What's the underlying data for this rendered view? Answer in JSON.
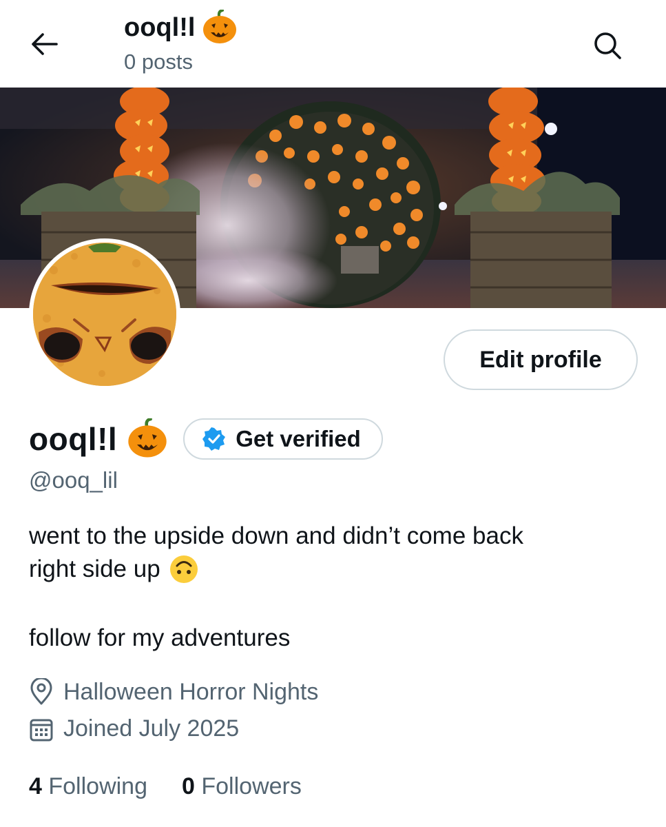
{
  "header": {
    "title": "ooql!l",
    "posts_count": "0 posts"
  },
  "profile": {
    "display_name": "ooql!l",
    "handle": "@ooq_lil",
    "bio_line1": "went to the upside down and didn’t come back",
    "bio_line2": "right side up",
    "bio_line3": "follow for my adventures",
    "location": "Halloween Horror Nights",
    "joined": "Joined July 2025"
  },
  "actions": {
    "edit_profile": "Edit profile",
    "get_verified": "Get verified"
  },
  "stats": {
    "following_count": "4",
    "following_label": "Following",
    "followers_count": "0",
    "followers_label": "Followers"
  },
  "icons": {
    "back": "arrow-left-icon",
    "search": "search-icon",
    "verified": "verified-badge-icon",
    "location": "location-pin-icon",
    "calendar": "calendar-icon",
    "emoji_title": "jack-o-lantern-emoji",
    "emoji_bio": "upside-down-face-emoji"
  },
  "colors": {
    "text_primary": "#0f1419",
    "text_secondary": "#536471",
    "border": "#cfd9de",
    "verified_blue": "#1d9bf0",
    "pumpkin_orange": "#f4900c"
  }
}
